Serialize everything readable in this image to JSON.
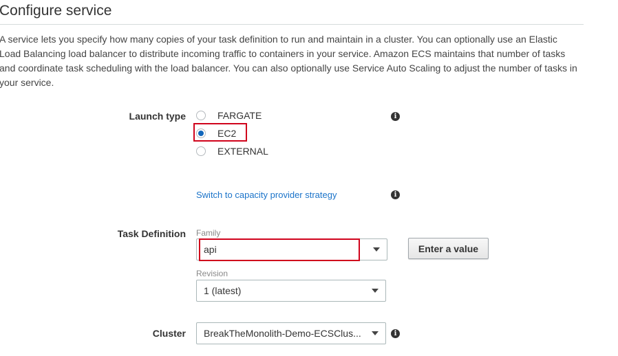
{
  "header": {
    "title": "Configure service",
    "description": "A service lets you specify how many copies of your task definition to run and maintain in a cluster. You can optionally use an Elastic Load Balancing load balancer to distribute incoming traffic to containers in your service. Amazon ECS maintains that number of tasks and coordinate task scheduling with the load balancer. You can also optionally use Service Auto Scaling to adjust the number of tasks in your service."
  },
  "launch_type": {
    "label": "Launch type",
    "options": [
      {
        "label": "FARGATE",
        "selected": false
      },
      {
        "label": "EC2",
        "selected": true
      },
      {
        "label": "EXTERNAL",
        "selected": false
      }
    ],
    "switch_link": "Switch to capacity provider strategy"
  },
  "task_definition": {
    "label": "Task Definition",
    "family_label": "Family",
    "family_value": "api",
    "enter_value_button": "Enter a value",
    "revision_label": "Revision",
    "revision_value": "1 (latest)"
  },
  "cluster": {
    "label": "Cluster",
    "value": "BreakTheMonolith-Demo-ECSClus..."
  },
  "icons": {
    "info": "info-icon",
    "dropdown": "chevron-down-icon"
  },
  "colors": {
    "highlight": "#d0021b",
    "link": "#1a73c9",
    "radio_selected": "#1166bb"
  }
}
